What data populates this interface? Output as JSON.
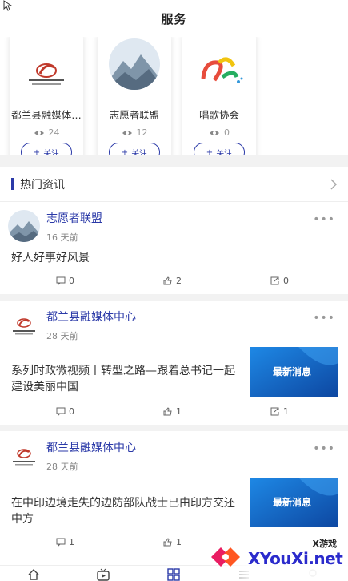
{
  "header": {
    "title": "服务"
  },
  "cards": [
    {
      "name": "都兰县融媒体…",
      "views": "24",
      "follow": "关注"
    },
    {
      "name": "志愿者联盟",
      "views": "12",
      "follow": "关注"
    },
    {
      "name": "唱歌协会",
      "views": "0",
      "follow": "关注"
    }
  ],
  "section": {
    "title": "热门资讯"
  },
  "posts": [
    {
      "author": "志愿者联盟",
      "time": "16 天前",
      "text": "好人好事好风景",
      "comments": "0",
      "likes": "2",
      "shares": "0"
    },
    {
      "author": "都兰县融媒体中心",
      "time": "28 天前",
      "text": "系列时政微视频丨转型之路—跟着总书记一起建设美丽中国",
      "thumb": "最新消息",
      "comments": "0",
      "likes": "1",
      "shares": "1"
    },
    {
      "author": "都兰县融媒体中心",
      "time": "28 天前",
      "text": "在中印边境走失的边防部队战士已由印方交还中方",
      "thumb": "最新消息",
      "comments": "1",
      "likes": "1",
      "shares": ""
    }
  ],
  "watermark": {
    "brand": "X游戏",
    "url": "XYouXi.net"
  },
  "icons": [
    "cursor-icon",
    "eye-icon",
    "plus-icon",
    "chevron-right-icon",
    "more-icon",
    "comment-icon",
    "like-icon",
    "share-icon",
    "home-icon",
    "video-icon",
    "grid-icon",
    "list-icon",
    "user-icon"
  ],
  "colors": {
    "accent": "#2b3aa8",
    "band": "#f2f2f2"
  }
}
